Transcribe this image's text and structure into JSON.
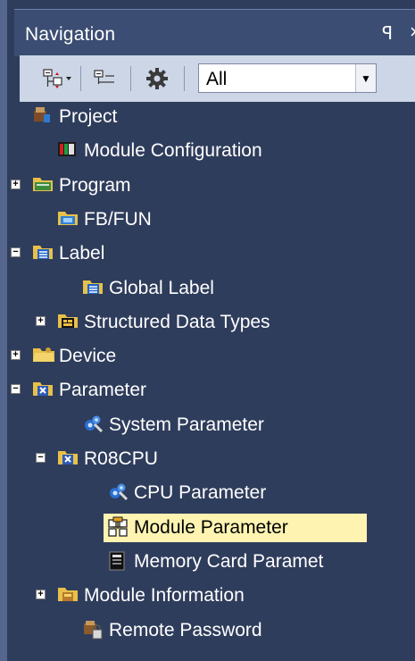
{
  "panel": {
    "title": "Navigation",
    "pin_glyph": "ꟼ",
    "close_glyph": "×"
  },
  "toolbar": {
    "filter_value": "All",
    "icons": [
      "expand-collapse-icon",
      "tree-view-icon",
      "gear-icon"
    ]
  },
  "tree": {
    "items": [
      {
        "label": "Project",
        "level": 0,
        "expander": "",
        "icon": "project-icon"
      },
      {
        "label": "Module Configuration",
        "level": 1,
        "expander": "",
        "icon": "module-configuration-icon"
      },
      {
        "label": "Program",
        "level": 0,
        "expander": "+",
        "icon": "program-icon"
      },
      {
        "label": "FB/FUN",
        "level": 1,
        "expander": "",
        "icon": "fb-fun-icon"
      },
      {
        "label": "Label",
        "level": 0,
        "expander": "-",
        "icon": "label-icon"
      },
      {
        "label": "Global Label",
        "level": 2,
        "expander": "",
        "icon": "global-label-icon"
      },
      {
        "label": "Structured Data Types",
        "level": 1,
        "expander": "+",
        "icon": "structured-data-icon"
      },
      {
        "label": "Device",
        "level": 0,
        "expander": "+",
        "icon": "device-icon"
      },
      {
        "label": "Parameter",
        "level": 0,
        "expander": "-",
        "icon": "parameter-icon"
      },
      {
        "label": "System Parameter",
        "level": 2,
        "expander": "",
        "icon": "system-parameter-icon"
      },
      {
        "label": "R08CPU",
        "level": 1,
        "expander": "-",
        "icon": "cpu-folder-icon"
      },
      {
        "label": "CPU Parameter",
        "level": 3,
        "expander": "",
        "icon": "cpu-parameter-icon"
      },
      {
        "label": "Module Parameter",
        "level": 3,
        "expander": "",
        "icon": "module-parameter-icon",
        "selected": true
      },
      {
        "label": "Memory Card Paramet",
        "level": 3,
        "expander": "",
        "icon": "memory-card-icon"
      },
      {
        "label": "Module Information",
        "level": 1,
        "expander": "+",
        "icon": "module-information-icon"
      },
      {
        "label": "Remote Password",
        "level": 2,
        "expander": "",
        "icon": "remote-password-icon"
      }
    ]
  },
  "colors": {
    "background": "#2f3d5c",
    "title_bar": "#3b4d72",
    "toolbar": "#cdd6e6",
    "selection": "#fff3b2",
    "text": "#ffffff"
  }
}
